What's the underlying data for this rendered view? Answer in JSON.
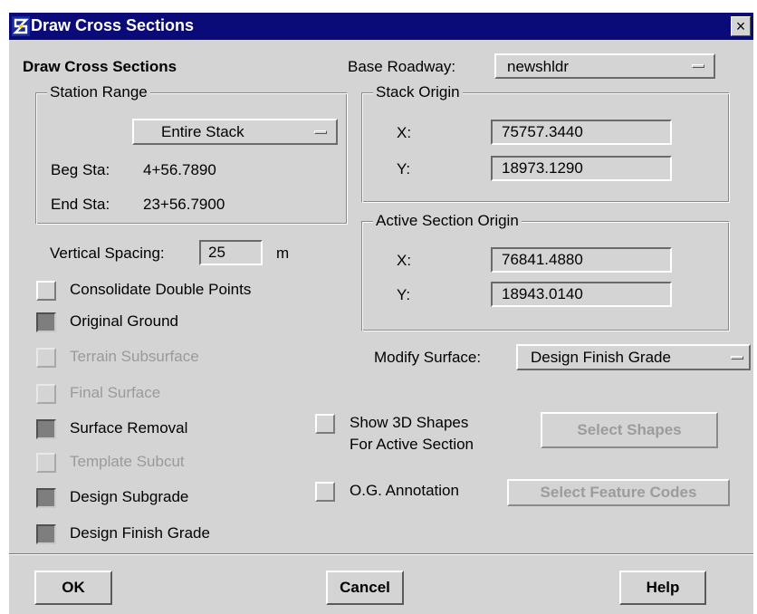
{
  "window": {
    "title": "Draw Cross Sections",
    "close_glyph": "×",
    "icon": "app-logo-icon"
  },
  "header": {
    "heading": "Draw Cross Sections",
    "base_roadway_label": "Base Roadway:",
    "base_roadway_value": "newshldr"
  },
  "station_range": {
    "legend": "Station Range",
    "mode": "Entire Stack",
    "beg_label": "Beg Sta:",
    "beg_value": "4+56.7890",
    "end_label": "End Sta:",
    "end_value": "23+56.7900"
  },
  "stack_origin": {
    "legend": "Stack Origin",
    "x_label": "X:",
    "x_value": "75757.3440",
    "y_label": "Y:",
    "y_value": "18973.1290"
  },
  "active_origin": {
    "legend": "Active Section Origin",
    "x_label": "X:",
    "x_value": "76841.4880",
    "y_label": "Y:",
    "y_value": "18943.0140"
  },
  "vertical_spacing": {
    "label": "Vertical Spacing:",
    "value": "25",
    "unit": "m"
  },
  "surfaces": [
    {
      "label": "Consolidate Double Points",
      "checked": false,
      "enabled": true
    },
    {
      "label": "Original Ground",
      "checked": true,
      "enabled": true
    },
    {
      "label": "Terrain Subsurface",
      "checked": false,
      "enabled": false
    },
    {
      "label": "Final Surface",
      "checked": false,
      "enabled": false
    },
    {
      "label": "Surface Removal",
      "checked": true,
      "enabled": true
    },
    {
      "label": "Template Subcut",
      "checked": false,
      "enabled": false
    },
    {
      "label": "Design Subgrade",
      "checked": true,
      "enabled": true
    },
    {
      "label": "Design Finish Grade",
      "checked": true,
      "enabled": true
    }
  ],
  "modify_surface": {
    "label": "Modify Surface:",
    "value": "Design Finish Grade"
  },
  "shapes": {
    "label_line1": "Show 3D Shapes",
    "label_line2": "For Active Section",
    "checked": false,
    "button": "Select Shapes"
  },
  "annotation": {
    "label": "O.G. Annotation",
    "checked": false,
    "button": "Select Feature Codes"
  },
  "buttons": {
    "ok": "OK",
    "cancel": "Cancel",
    "help": "Help"
  },
  "colors": {
    "titlebar": "#0a0a78",
    "dialog_bg": "#d4d4d4",
    "checked_fill": "#7e7e7e",
    "disabled_text": "#9a9a9a"
  }
}
